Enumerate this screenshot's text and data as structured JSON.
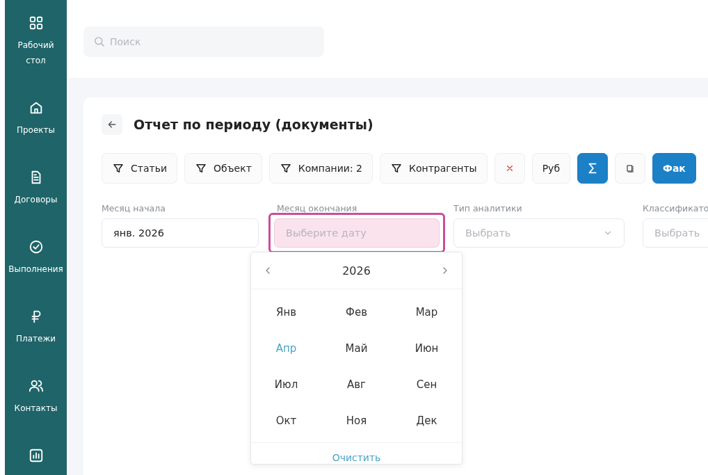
{
  "sidebar": {
    "items": [
      {
        "label": "Рабочий стол"
      },
      {
        "label": "Проекты"
      },
      {
        "label": "Договоры"
      },
      {
        "label": "Выполнения"
      },
      {
        "label": "Платежи"
      },
      {
        "label": "Контакты"
      }
    ]
  },
  "search": {
    "placeholder": "Поиск"
  },
  "page": {
    "title": "Отчет по периоду (документы)"
  },
  "toolbar": [
    {
      "kind": "filter",
      "label": "Статьи"
    },
    {
      "kind": "filter",
      "label": "Объект"
    },
    {
      "kind": "filter",
      "label": "Компании: 2"
    },
    {
      "kind": "filter",
      "label": "Контрагенты"
    },
    {
      "kind": "clear"
    },
    {
      "kind": "text",
      "label": "Руб"
    },
    {
      "kind": "sum"
    },
    {
      "kind": "frame"
    },
    {
      "kind": "primary",
      "label": "Фак"
    }
  ],
  "fields": [
    {
      "kind": "input",
      "label": "Месяц начала",
      "value": "янв. 2026",
      "highlighted": false
    },
    {
      "kind": "input",
      "label": "Месяц окончания",
      "placeholder": "Выберите дату",
      "highlighted": true
    },
    {
      "kind": "select",
      "label": "Тип аналитики",
      "placeholder": "Выбрать",
      "highlighted": false
    },
    {
      "kind": "select",
      "label": "Классификато",
      "placeholder": "Выбрать",
      "highlighted": false
    }
  ],
  "month_picker": {
    "year": "2026",
    "clear": "Очистить",
    "months": [
      {
        "label": "Янв",
        "current": false
      },
      {
        "label": "Фев",
        "current": false
      },
      {
        "label": "Мар",
        "current": false
      },
      {
        "label": "Апр",
        "current": true
      },
      {
        "label": "Май",
        "current": false
      },
      {
        "label": "Июн",
        "current": false
      },
      {
        "label": "Июл",
        "current": false
      },
      {
        "label": "Авг",
        "current": false
      },
      {
        "label": "Сен",
        "current": false
      },
      {
        "label": "Окт",
        "current": false
      },
      {
        "label": "Ноя",
        "current": false
      },
      {
        "label": "Дек",
        "current": false
      }
    ]
  }
}
